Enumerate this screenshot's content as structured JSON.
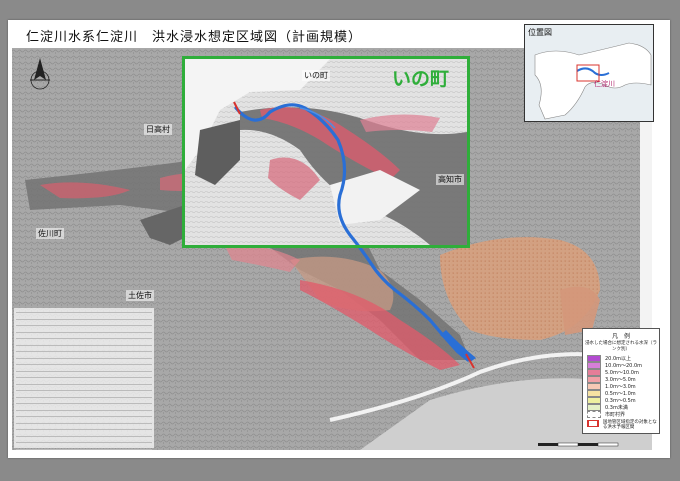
{
  "title": "仁淀川水系仁淀川　洪水浸水想定区域図（計画規模）",
  "zoom_label": "いの町",
  "places": {
    "ino_town": "いの町",
    "hidaka_village": "日高村",
    "kochi_city": "高知市",
    "sakawa_town": "佐川町",
    "tosa_city": "土佐市"
  },
  "inset": {
    "title": "位置図",
    "river_label": "仁淀川"
  },
  "legend": {
    "title": "凡　例",
    "subtitle": "浸水した場合に想定される水深（ランク別）",
    "items": [
      {
        "label": "20.0m以上",
        "color": "#b24bd0"
      },
      {
        "label": "10.0m〜20.0m",
        "color": "#d67fd8"
      },
      {
        "label": "5.0m〜10.0m",
        "color": "#e67d98"
      },
      {
        "label": "3.0m〜5.0m",
        "color": "#f2a0a6"
      },
      {
        "label": "1.0m〜3.0m",
        "color": "#f8c9b5"
      },
      {
        "label": "0.5m〜1.0m",
        "color": "#f6e2a2"
      },
      {
        "label": "0.3m〜0.5m",
        "color": "#eef0a0"
      },
      {
        "label": "0.3m未満",
        "color": "#e5f1c7"
      },
      {
        "label": "市町村界",
        "color": "#ffffff"
      }
    ],
    "footnote": "国地管区域指定の対象となる洪水予報区間",
    "footnote_color": "#d8332e"
  },
  "colors": {
    "zoom_green": "#2fae3a",
    "river_blue": "#2a6fd6",
    "flood_red": "#e84a5f",
    "flood_orange": "#eab08a"
  },
  "icons": {
    "north_arrow": "north-arrow-icon",
    "scale_bar": "scale-bar-icon"
  }
}
